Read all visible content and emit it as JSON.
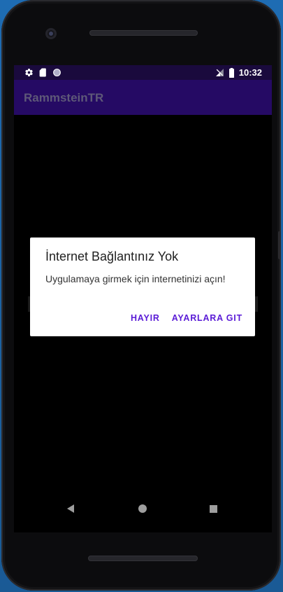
{
  "status_bar": {
    "time": "10:32",
    "icons_left": [
      "gear-icon",
      "sd-card-icon",
      "circle-icon"
    ],
    "icons_right": [
      "no-signal-icon",
      "battery-icon"
    ]
  },
  "app_bar": {
    "title": "RammsteinTR"
  },
  "dialog": {
    "title": "İnternet Bağlantınız Yok",
    "message": "Uygulamaya girmek için internetinizi açın!",
    "negative_button": "HAYIR",
    "positive_button": "AYARLARA GIT"
  },
  "nav_bar": {
    "buttons": [
      "back-icon",
      "home-icon",
      "recents-icon"
    ]
  },
  "colors": {
    "status_bar": "#1a0a3d",
    "app_bar": "#250a64",
    "dialog_button": "#5a1bd6",
    "background": "#000000"
  }
}
